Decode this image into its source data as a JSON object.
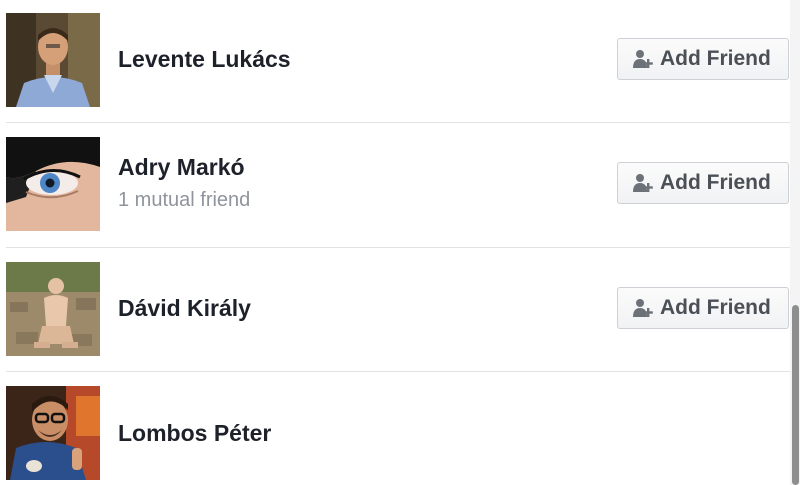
{
  "people": [
    {
      "name": "Levente Lukács",
      "mutual": "",
      "button_label": "Add Friend",
      "avatar_icon": "avatar-photo-man-blue-shirt"
    },
    {
      "name": "Adry Markó",
      "mutual": "1 mutual friend",
      "button_label": "Add Friend",
      "avatar_icon": "avatar-photo-eye-closeup"
    },
    {
      "name": "Dávid Király",
      "mutual": "",
      "button_label": "Add Friend",
      "avatar_icon": "avatar-photo-person-on-rocks"
    },
    {
      "name": "Lombos Péter",
      "mutual": "",
      "button_label": "",
      "avatar_icon": "avatar-photo-man-with-glasses"
    }
  ],
  "colors": {
    "name_text": "#1d2129",
    "mutual_text": "#90949c",
    "button_text": "#4b4f56",
    "divider": "#e1e2e5"
  }
}
